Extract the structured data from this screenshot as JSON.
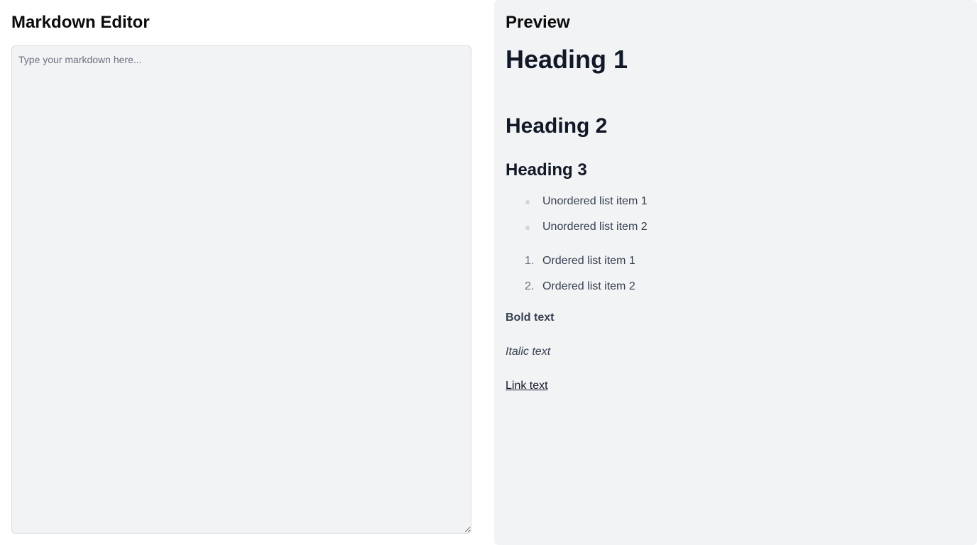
{
  "editor": {
    "title": "Markdown Editor",
    "value": "",
    "placeholder": "Type your markdown here..."
  },
  "preview": {
    "title": "Preview",
    "h1": "Heading 1",
    "h2": "Heading 2",
    "h3": "Heading 3",
    "unordered": [
      "Unordered list item 1",
      "Unordered list item 2"
    ],
    "ordered": [
      "Ordered list item 1",
      "Ordered list item 2"
    ],
    "ordered_numbers": [
      "1.",
      "2."
    ],
    "bold": "Bold text",
    "italic": "Italic text",
    "link": "Link text"
  },
  "colors": {
    "panel_bg": "#f2f3f5",
    "heading": "#111827",
    "body_text": "#374151",
    "bullet": "#d1d5db"
  }
}
